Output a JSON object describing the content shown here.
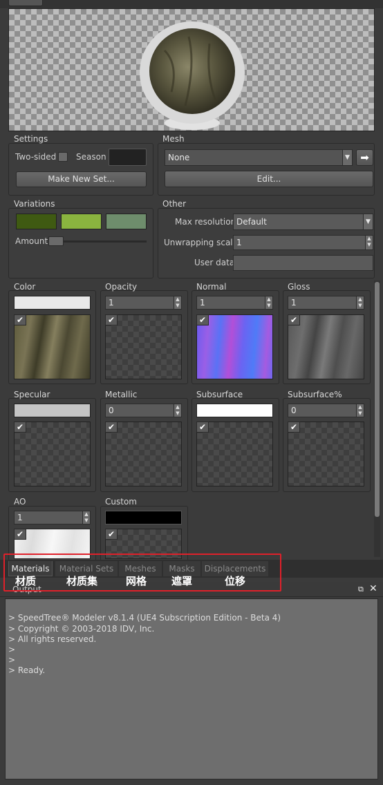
{
  "preview": {},
  "settings": {
    "title": "Settings",
    "two_sided_label": "Two-sided",
    "season_label": "Season",
    "make_new_set": "Make New Set..."
  },
  "mesh": {
    "title": "Mesh",
    "value": "None",
    "edit": "Edit..."
  },
  "variations": {
    "title": "Variations",
    "swatches": [
      "#3f5a12",
      "#8ab43f",
      "#6e8d6c"
    ],
    "amount_label": "Amount",
    "amount_value": 0
  },
  "other": {
    "title": "Other",
    "max_resolution_label": "Max resolution",
    "max_resolution_value": "Default",
    "unwrapping_scale_label": "Unwrapping scale",
    "unwrapping_scale_value": "1",
    "user_data_label": "User data",
    "user_data_value": ""
  },
  "channels": {
    "color": {
      "title": "Color"
    },
    "opacity": {
      "title": "Opacity",
      "value": "1"
    },
    "normal": {
      "title": "Normal",
      "value": "1"
    },
    "gloss": {
      "title": "Gloss",
      "value": "1"
    },
    "specular": {
      "title": "Specular"
    },
    "metallic": {
      "title": "Metallic",
      "value": "0"
    },
    "subsurface": {
      "title": "Subsurface"
    },
    "subsurface_pct": {
      "title": "Subsurface%",
      "value": "0"
    },
    "ao": {
      "title": "AO",
      "value": "1"
    },
    "custom": {
      "title": "Custom"
    }
  },
  "tabs": [
    "Materials",
    "Material Sets",
    "Meshes",
    "Masks",
    "Displacements"
  ],
  "tab_annotations": [
    "材质",
    "材质集",
    "网格",
    "遮罩",
    "位移"
  ],
  "output": {
    "title": "Output",
    "lines": [
      "> SpeedTree® Modeler v8.1.4 (UE4 Subscription Edition - Beta 4)",
      "> Copyright © 2003-2018 IDV, Inc.",
      "> All rights reserved.",
      ">",
      ">",
      "> Ready."
    ]
  },
  "colors": {
    "highlight": "#e0202a"
  }
}
